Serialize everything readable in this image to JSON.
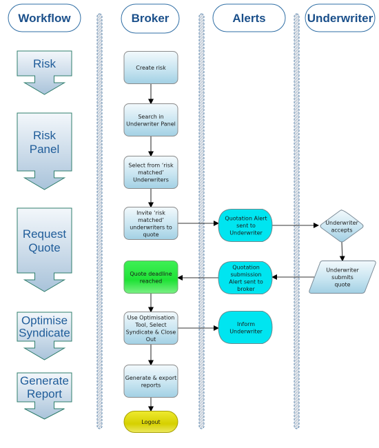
{
  "lanes": [
    {
      "id": "workflow",
      "label": "Workflow"
    },
    {
      "id": "broker",
      "label": "Broker"
    },
    {
      "id": "alerts",
      "label": "Alerts"
    },
    {
      "id": "underwriter",
      "label": "Underwriter"
    }
  ],
  "workflow_steps": [
    {
      "id": "risk",
      "lines": [
        "Risk"
      ]
    },
    {
      "id": "risk-panel",
      "lines": [
        "Risk",
        "Panel"
      ]
    },
    {
      "id": "request-quote",
      "lines": [
        "Request",
        "Quote"
      ]
    },
    {
      "id": "optimise-syndicate",
      "lines": [
        "Optimise",
        "Syndicate"
      ]
    },
    {
      "id": "generate-report",
      "lines": [
        "Generate",
        "Report"
      ]
    }
  ],
  "nodes": [
    {
      "id": "create-risk",
      "shape": "process",
      "lines": [
        "Create risk"
      ]
    },
    {
      "id": "search-panel",
      "shape": "process",
      "lines": [
        "Search in",
        "Underwriter Panel"
      ]
    },
    {
      "id": "select-matched",
      "shape": "process",
      "lines": [
        "Select from ‘risk",
        "matched’",
        "Underwriters"
      ]
    },
    {
      "id": "invite-underwriters",
      "shape": "process",
      "lines": [
        "Invite ‘risk",
        "matched’",
        "underwriters to",
        "quote"
      ]
    },
    {
      "id": "quote-deadline",
      "shape": "process-green",
      "lines": [
        "Quote deadline",
        "reached"
      ]
    },
    {
      "id": "use-optimisation",
      "shape": "process",
      "lines": [
        "Use Optimisation",
        "Tool, Select",
        "Syndicate & Close",
        "Out"
      ]
    },
    {
      "id": "generate-export",
      "shape": "process",
      "lines": [
        "Generate & export",
        "reports"
      ]
    },
    {
      "id": "logout",
      "shape": "terminator",
      "lines": [
        "Logout"
      ]
    },
    {
      "id": "quotation-alert",
      "shape": "display",
      "lines": [
        "Quotation Alert",
        "sent to",
        "Underwriter"
      ]
    },
    {
      "id": "quotation-submission-alert",
      "shape": "display",
      "lines": [
        "Quotation",
        "submission",
        "Alert sent to",
        "broker"
      ]
    },
    {
      "id": "inform-underwriter",
      "shape": "display",
      "lines": [
        "Inform",
        "Underwriter"
      ]
    },
    {
      "id": "underwriter-accepts",
      "shape": "decision",
      "lines": [
        "Underwriter",
        "accepts"
      ]
    },
    {
      "id": "underwriter-submits",
      "shape": "data",
      "lines": [
        "Underwriter",
        "submits",
        "quote"
      ]
    }
  ],
  "edges": [
    {
      "from": "create-risk",
      "to": "search-panel"
    },
    {
      "from": "search-panel",
      "to": "select-matched"
    },
    {
      "from": "select-matched",
      "to": "invite-underwriters"
    },
    {
      "from": "invite-underwriters",
      "to": "quotation-alert"
    },
    {
      "from": "quotation-alert",
      "to": "underwriter-accepts"
    },
    {
      "from": "underwriter-accepts",
      "to": "underwriter-submits"
    },
    {
      "from": "underwriter-submits",
      "to": "quotation-submission-alert"
    },
    {
      "from": "quotation-submission-alert",
      "to": "quote-deadline"
    },
    {
      "from": "quote-deadline",
      "to": "use-optimisation"
    },
    {
      "from": "use-optimisation",
      "to": "inform-underwriter"
    },
    {
      "from": "use-optimisation",
      "to": "generate-export"
    },
    {
      "from": "generate-export",
      "to": "logout"
    }
  ],
  "colors": {
    "header_border": "#2e6da4",
    "header_text": "#1a4f8a",
    "workflow_arrow_border": "#2e7d6b",
    "workflow_arrow_top": "#eef4fa",
    "workflow_arrow_bottom": "#a9c3da",
    "workflow_text": "#1f5c99",
    "process_top": "#eef6fb",
    "process_bottom": "#a8d4e6",
    "process_border": "#8a8a8a",
    "deadline_fill": "#22e83a",
    "logout_fill": "#d9d400",
    "alert_fill": "#00e5f0",
    "separator_fill": "#d6dde6",
    "separator_border": "#3a6e9e"
  }
}
